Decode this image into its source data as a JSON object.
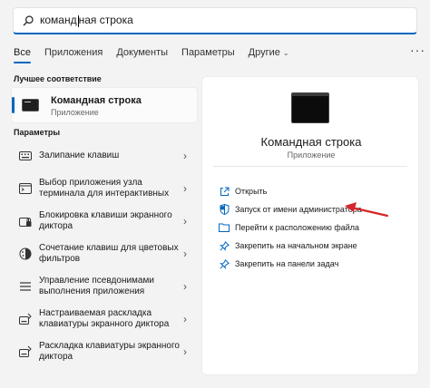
{
  "search": {
    "query": "команд",
    "query_rest": "ная строка"
  },
  "tabs": [
    {
      "label": "Все"
    },
    {
      "label": "Приложения"
    },
    {
      "label": "Документы"
    },
    {
      "label": "Параметры"
    },
    {
      "label": "Другие"
    }
  ],
  "more_label": "···",
  "best_match": {
    "section_title": "Лучшее соответствие",
    "name": "Командная строка",
    "kind": "Приложение"
  },
  "settings": {
    "section_title": "Параметры",
    "items": [
      {
        "label": "Залипание клавиш",
        "icon": "keyboard-icon"
      },
      {
        "label": "Выбор приложения узла терминала для интерактивных",
        "icon": "terminal-settings-icon"
      },
      {
        "label": "Блокировка клавиши экранного диктора",
        "icon": "narrator-lock-icon"
      },
      {
        "label": "Сочетание клавиш для цветовых фильтров",
        "icon": "color-filter-icon"
      },
      {
        "label": "Управление псевдонимами выполнения приложения",
        "icon": "app-alias-icon"
      },
      {
        "label": "Настраиваемая раскладка клавиатуры экранного диктора",
        "icon": "narrator-keyboard-icon"
      },
      {
        "label": "Раскладка клавиатуры экранного диктора",
        "icon": "narrator-keyboard-icon"
      }
    ]
  },
  "panel": {
    "name": "Командная строка",
    "kind": "Приложение",
    "actions": [
      {
        "label": "Открыть",
        "icon": "open-icon"
      },
      {
        "label": "Запуск от имени администратора",
        "icon": "shield-icon"
      },
      {
        "label": "Перейти к расположению файла",
        "icon": "folder-icon"
      },
      {
        "label": "Закрепить на начальном экране",
        "icon": "pin-icon"
      },
      {
        "label": "Закрепить на панели задач",
        "icon": "pin-icon"
      }
    ]
  },
  "colors": {
    "accent": "#0067c0",
    "annotation_arrow": "#d6262b"
  }
}
